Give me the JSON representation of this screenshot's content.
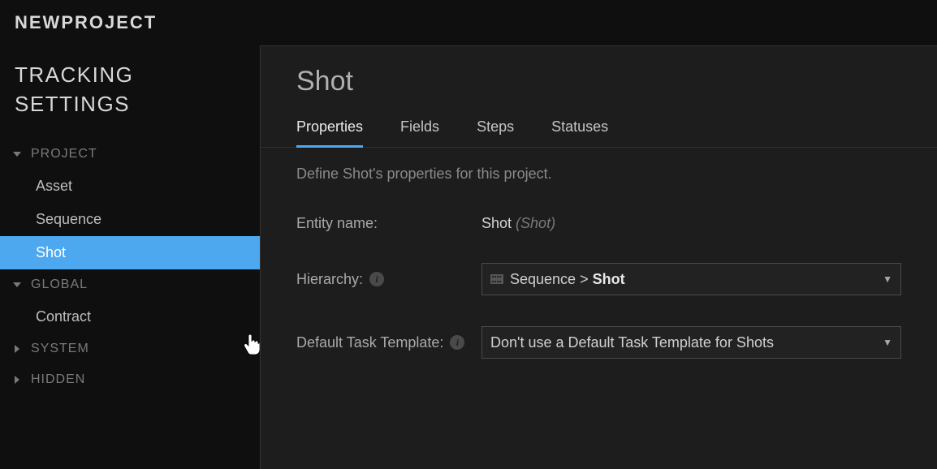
{
  "topbar": {
    "project_name": "NEWPROJECT"
  },
  "sidebar": {
    "title_line1": "TRACKING",
    "title_line2": "SETTINGS",
    "sections": [
      {
        "name": "PROJECT",
        "expanded": true,
        "items": [
          {
            "label": "Asset",
            "active": false
          },
          {
            "label": "Sequence",
            "active": false
          },
          {
            "label": "Shot",
            "active": true
          }
        ]
      },
      {
        "name": "GLOBAL",
        "expanded": true,
        "items": [
          {
            "label": "Contract",
            "active": false
          }
        ]
      },
      {
        "name": "SYSTEM",
        "expanded": false,
        "items": []
      },
      {
        "name": "HIDDEN",
        "expanded": false,
        "items": []
      }
    ]
  },
  "main": {
    "title": "Shot",
    "tabs": [
      {
        "label": "Properties",
        "active": true
      },
      {
        "label": "Fields",
        "active": false
      },
      {
        "label": "Steps",
        "active": false
      },
      {
        "label": "Statuses",
        "active": false
      }
    ],
    "description": "Define Shot's properties for this project.",
    "form": {
      "entity_name_label": "Entity name:",
      "entity_name_value": "Shot",
      "entity_name_paren": "(Shot)",
      "hierarchy_label": "Hierarchy:",
      "hierarchy_path_prefix": "Sequence > ",
      "hierarchy_path_bold": "Shot",
      "template_label": "Default Task Template:",
      "template_value": "Don't use a Default Task Template for Shots"
    }
  }
}
